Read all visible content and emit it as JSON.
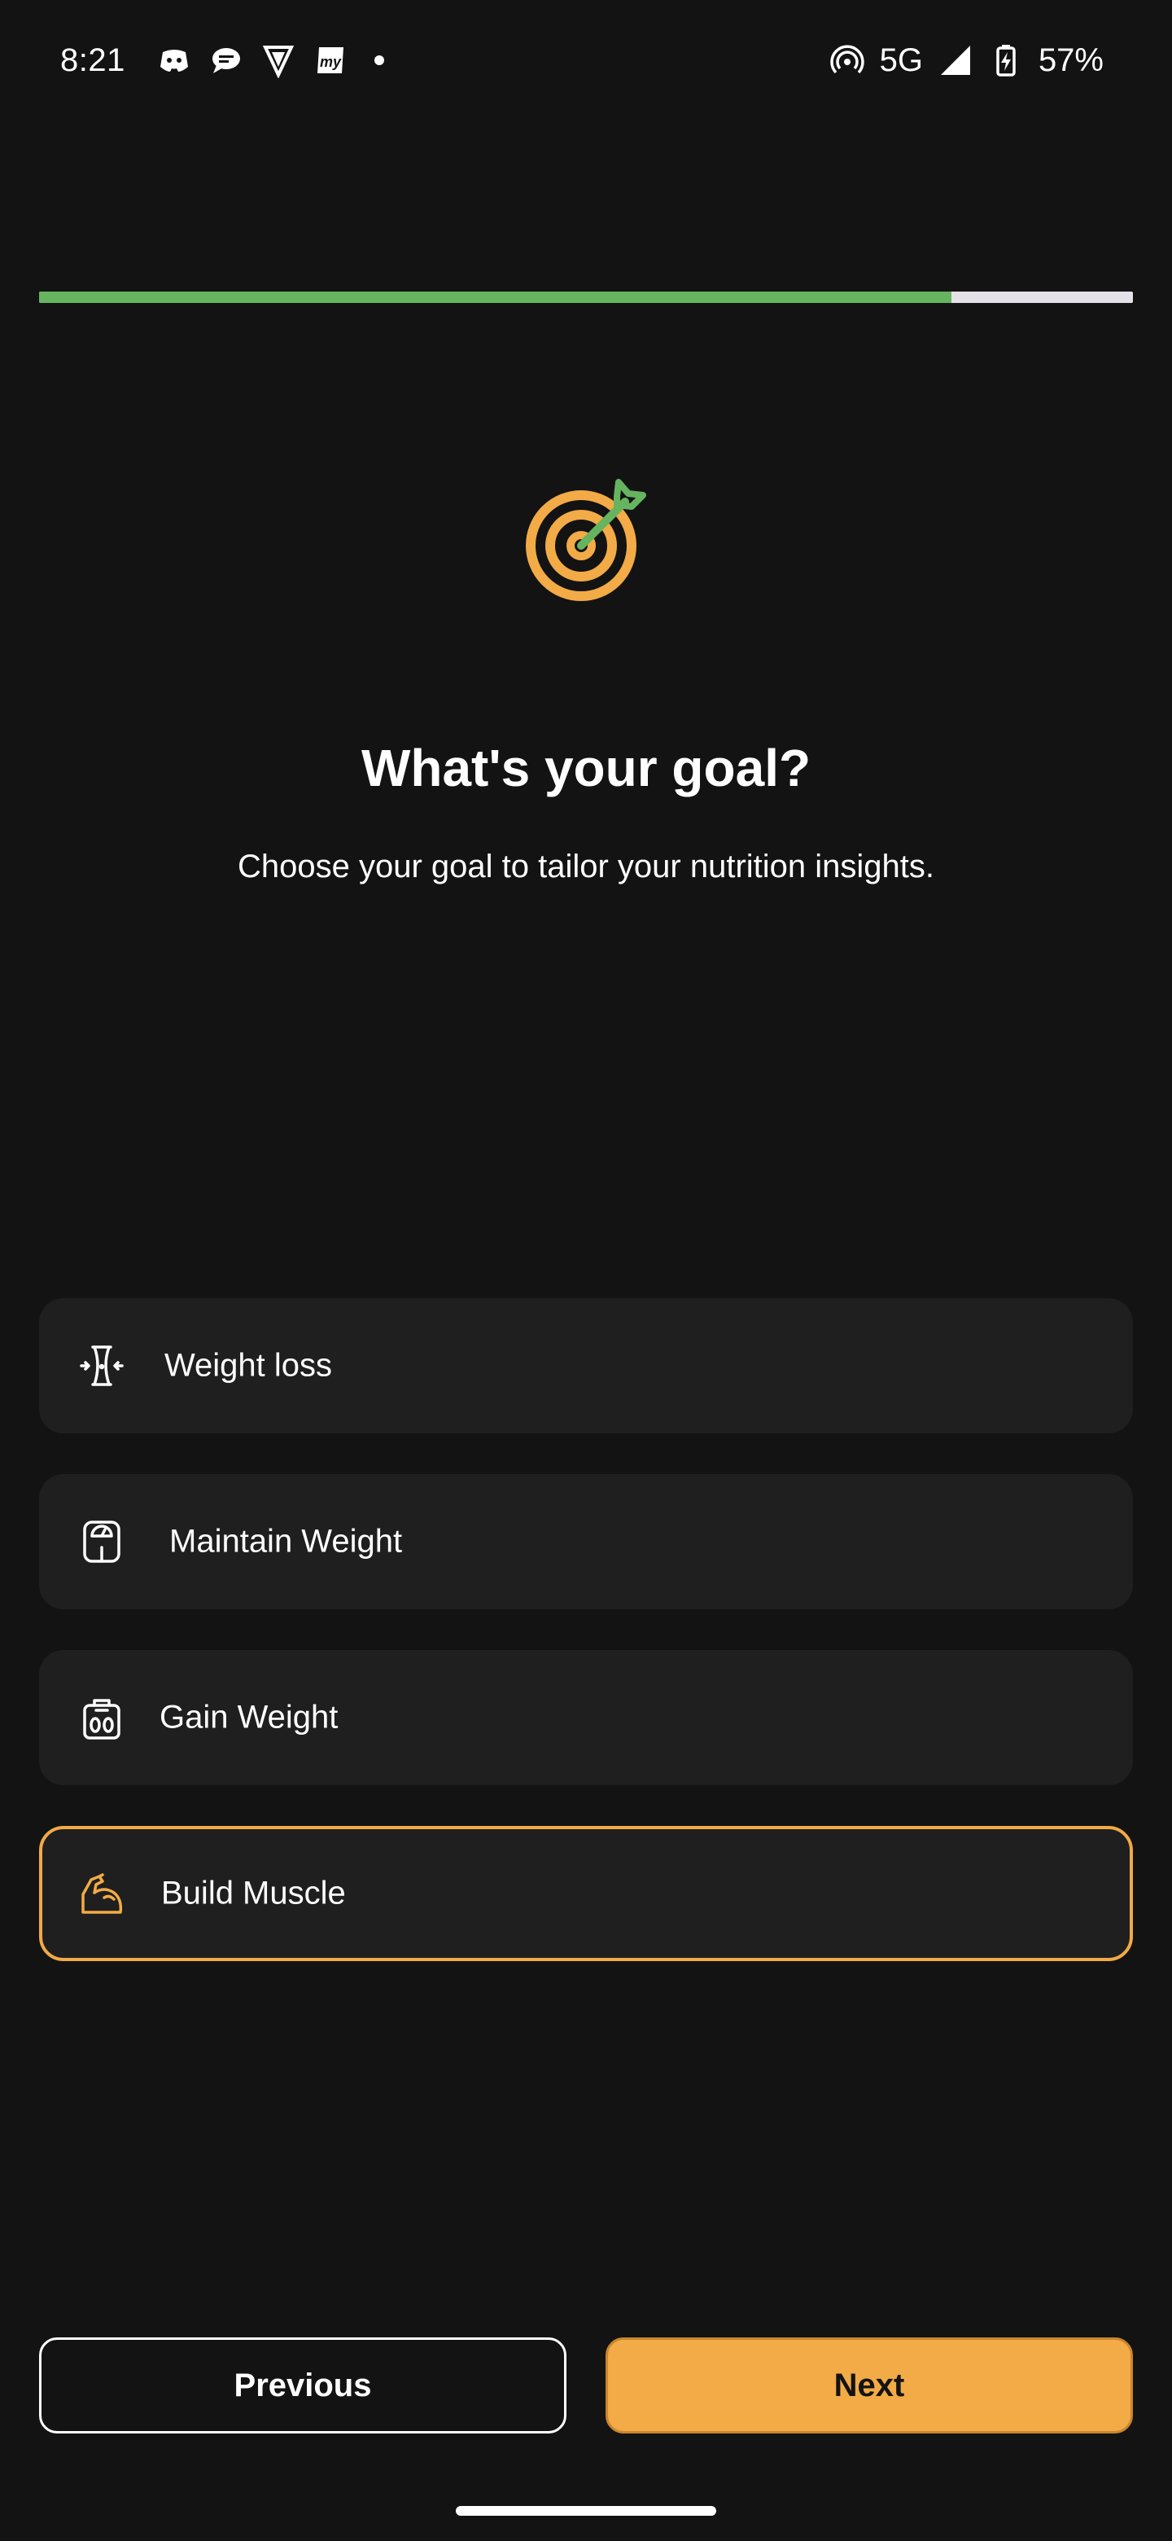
{
  "status_bar": {
    "time": "8:21",
    "notification_icons": [
      "discord-icon",
      "messages-icon",
      "shield-v-icon",
      "myntra-icon"
    ],
    "network": "5G",
    "battery": "57%"
  },
  "progress": {
    "fraction": 0.834
  },
  "hero": {
    "icon": "target-arrow-icon",
    "title": "What's your goal?",
    "subtitle": "Choose your goal to tailor your nutrition insights."
  },
  "goals": [
    {
      "label": "Weight loss",
      "icon": "waist-slim-icon",
      "selected": false
    },
    {
      "label": "Maintain Weight",
      "icon": "bathroom-scale-icon",
      "selected": false
    },
    {
      "label": "Gain Weight",
      "icon": "weight-bag-icon",
      "selected": false
    },
    {
      "label": "Build Muscle",
      "icon": "flexed-biceps-icon",
      "selected": true
    }
  ],
  "buttons": {
    "previous": "Previous",
    "next": "Next"
  },
  "colors": {
    "background": "#131313",
    "card": "#1f1f1f",
    "accent": "#f2ab46",
    "progress_fill": "#66b45f",
    "progress_track": "#e4e1e8"
  }
}
